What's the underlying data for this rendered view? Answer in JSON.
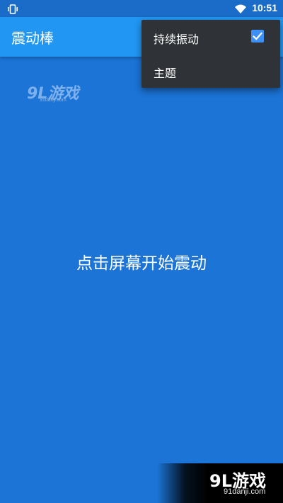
{
  "status_bar": {
    "time": "10:51",
    "icons": [
      "vibrate-icon",
      "wifi-icon"
    ]
  },
  "app_bar": {
    "title": "震动棒"
  },
  "main": {
    "instruction": "点击屏幕开始震动"
  },
  "overflow_menu": {
    "items": [
      {
        "label": "持续振动",
        "checked": true
      },
      {
        "label": "主题"
      }
    ]
  },
  "watermark_top": {
    "logo": "9L游戏",
    "url": "91danji.com"
  },
  "watermark_bottom": {
    "logo": "9L游戏",
    "url": "91danji.com"
  },
  "colors": {
    "background": "#1B74D6",
    "app_bar": "#2196F3",
    "status_bar": "#1A6CC8",
    "menu": "#2F3236",
    "checkbox": "#3E90F5"
  }
}
